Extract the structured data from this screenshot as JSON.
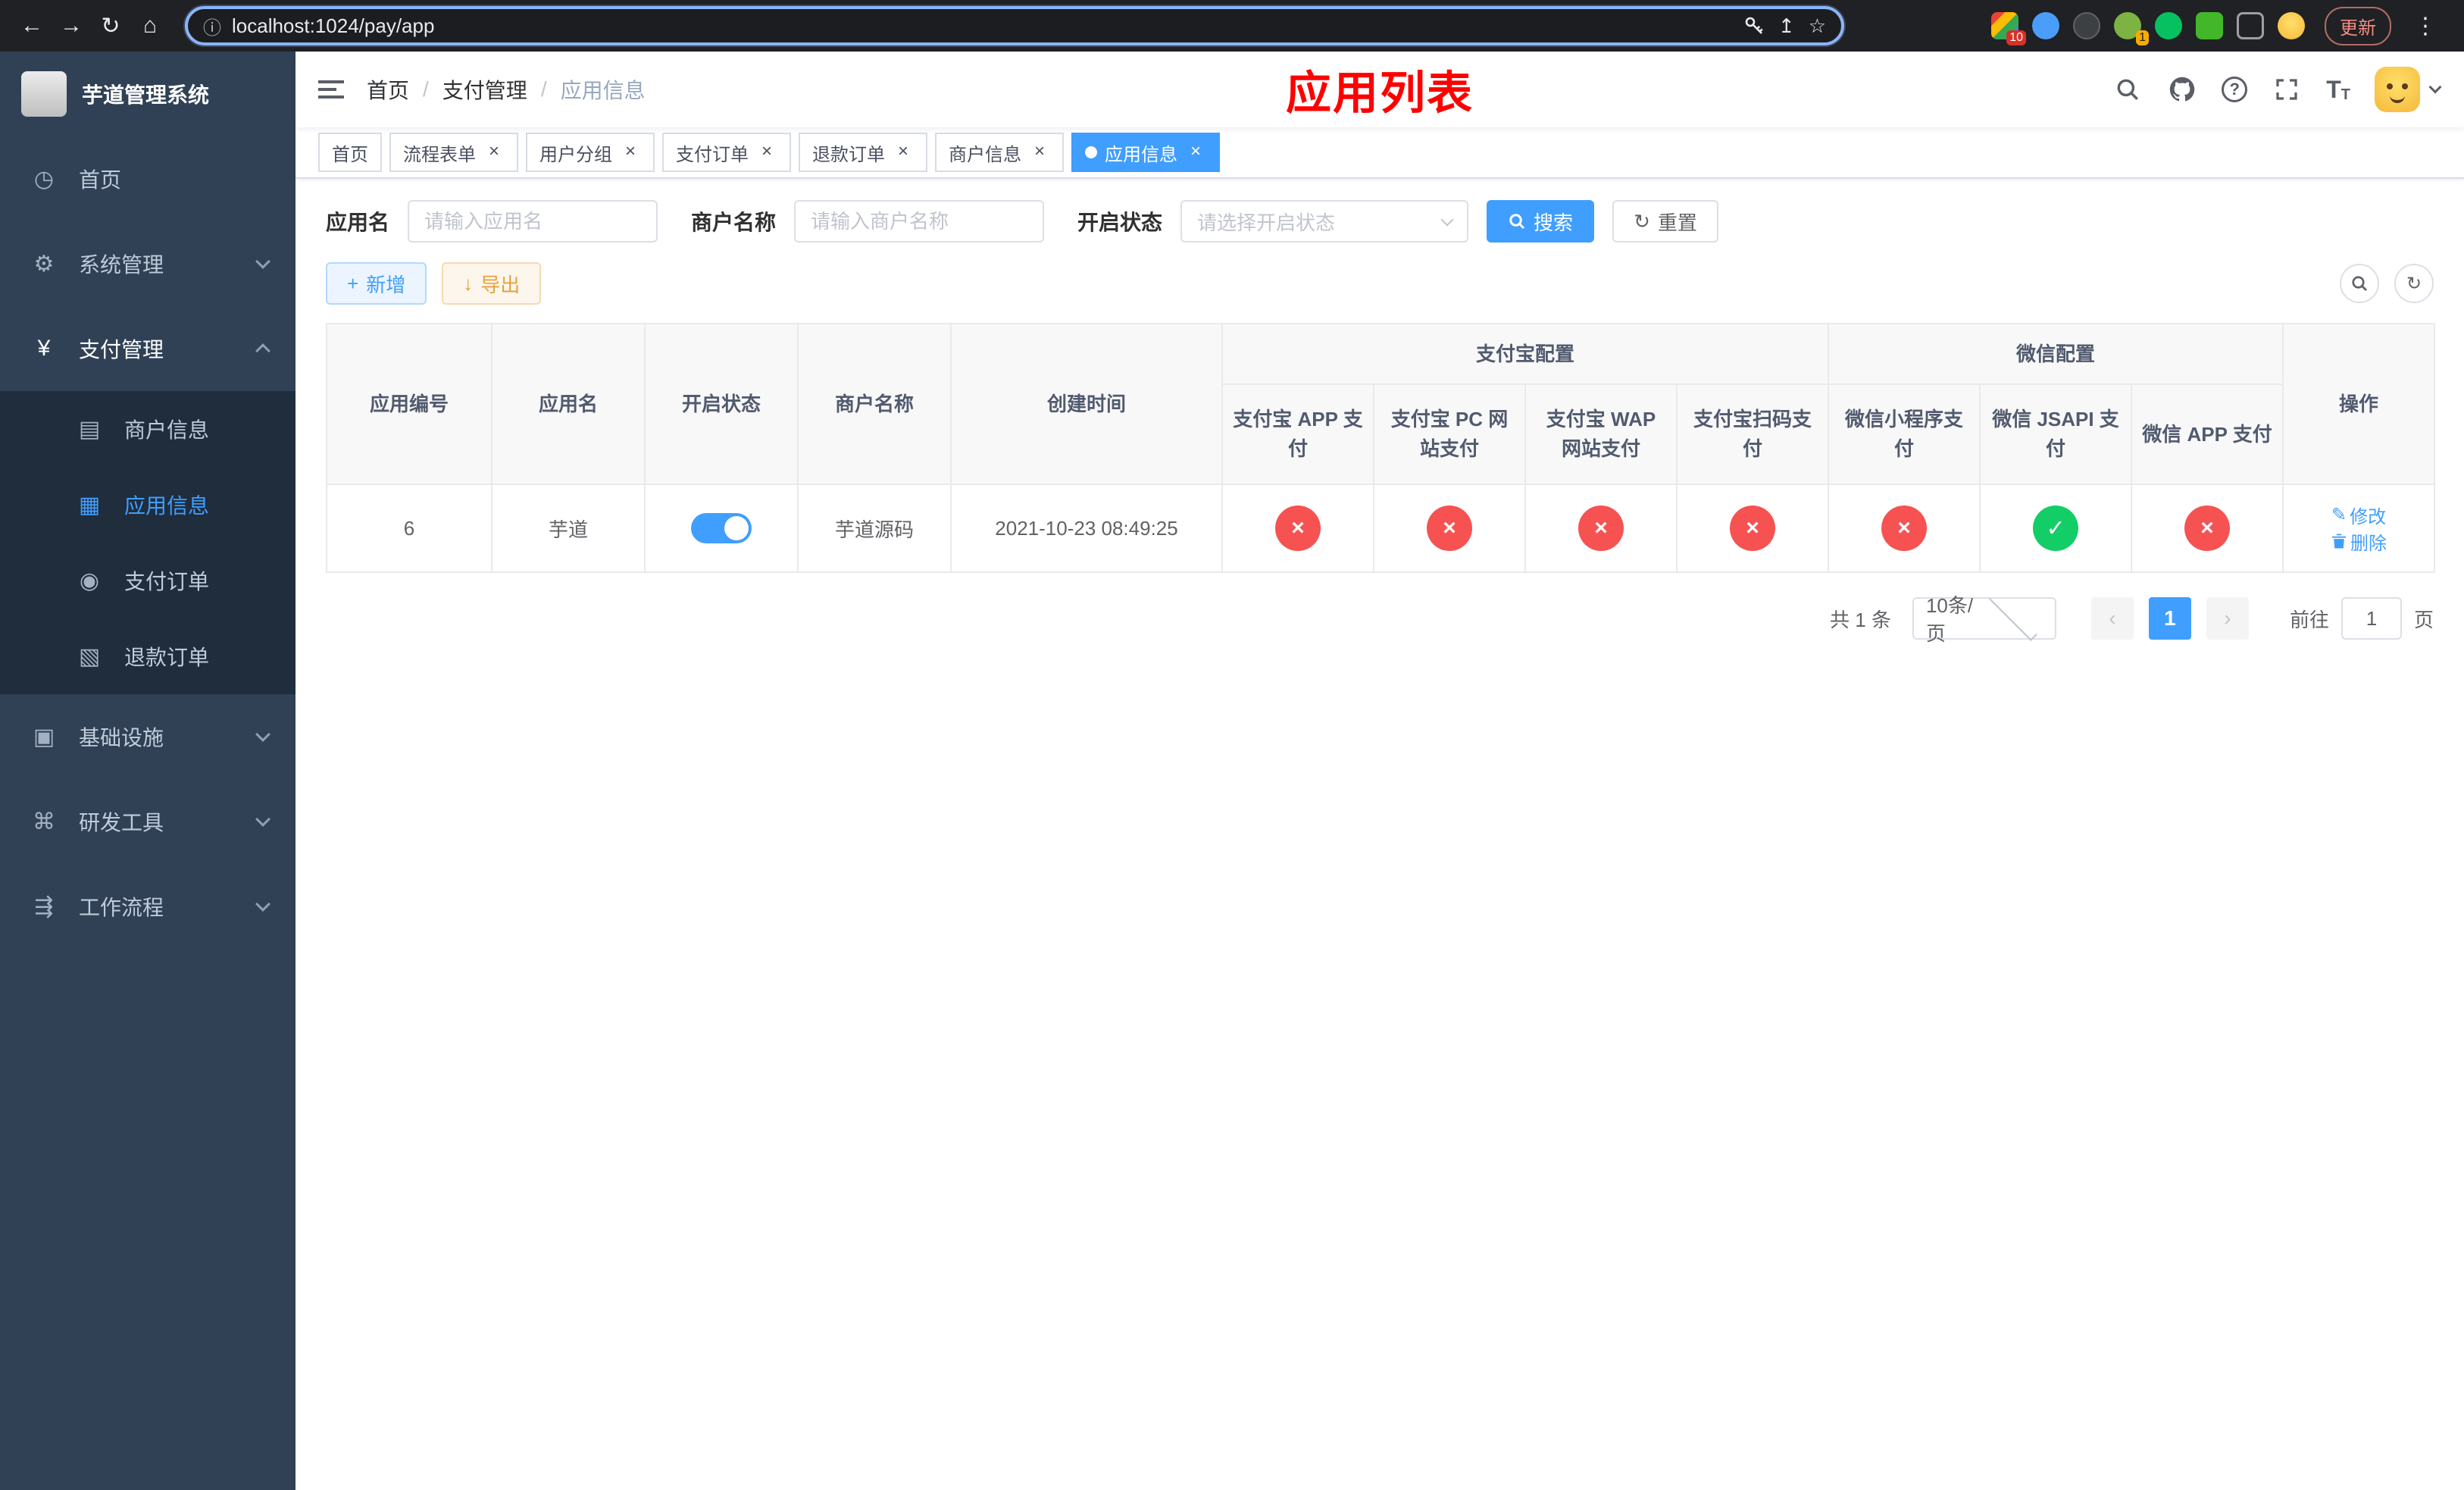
{
  "colors": {
    "accent": "#409eff",
    "title_red": "#ff0000",
    "status_fail": "#f65252",
    "status_ok": "#13ce66",
    "sidebar_bg": "#304156",
    "submenu_bg": "#1f2d3d"
  },
  "browser": {
    "url": "localhost:1024/pay/app",
    "update_label": "更新",
    "ext_badge_red": "10",
    "ext_badge_yellow": "1"
  },
  "icons": {
    "back": "←",
    "forward": "→",
    "reload": "↻",
    "home": "⌂",
    "info": "ⓘ",
    "share": "↥",
    "star": "☆",
    "menu_dots": "⋮",
    "dashboard": "◷",
    "gear": "⚙",
    "yen": "¥",
    "card": "▤",
    "grid": "▦",
    "order": "◉",
    "refund": "▧",
    "infra": "▣",
    "tools": "⌘",
    "flow": "⇶",
    "question": "?",
    "text_size": "T",
    "plus": "+",
    "download": "↓",
    "reset": "↻",
    "edit": "✎",
    "close": "×",
    "prev": "‹",
    "next": "›"
  },
  "sidebar": {
    "title": "芋道管理系统",
    "items": [
      {
        "label": "首页"
      },
      {
        "label": "系统管理"
      },
      {
        "label": "支付管理"
      },
      {
        "label": "商户信息"
      },
      {
        "label": "应用信息"
      },
      {
        "label": "支付订单"
      },
      {
        "label": "退款订单"
      },
      {
        "label": "基础设施"
      },
      {
        "label": "研发工具"
      },
      {
        "label": "工作流程"
      }
    ]
  },
  "navbar": {
    "breadcrumb": {
      "separator": "/",
      "items": [
        {
          "label": "首页"
        },
        {
          "label": "支付管理"
        },
        {
          "label": "应用信息"
        }
      ]
    },
    "page_title": "应用列表"
  },
  "tabs": [
    {
      "label": "首页"
    },
    {
      "label": "流程表单"
    },
    {
      "label": "用户分组"
    },
    {
      "label": "支付订单"
    },
    {
      "label": "退款订单"
    },
    {
      "label": "商户信息"
    },
    {
      "label": "应用信息"
    }
  ],
  "filters": {
    "app_name_label": "应用名",
    "app_name_placeholder": "请输入应用名",
    "merchant_label": "商户名称",
    "merchant_placeholder": "请输入商户名称",
    "status_label": "开启状态",
    "status_placeholder": "请选择开启状态",
    "search_label": "搜索",
    "reset_label": "重置"
  },
  "toolbar": {
    "add_label": "新增",
    "export_label": "导出"
  },
  "table": {
    "headers": {
      "app_id": "应用编号",
      "app_name": "应用名",
      "status": "开启状态",
      "merchant": "商户名称",
      "created": "创建时间",
      "alipay_group": "支付宝配置",
      "wechat_group": "微信配置",
      "alipay_app": "支付宝 APP 支付",
      "alipay_pc": "支付宝 PC 网站支付",
      "alipay_wap": "支付宝 WAP 网站支付",
      "alipay_qr": "支付宝扫码支付",
      "wx_mini": "微信小程序支付",
      "wx_jsapi": "微信 JSAPI 支付",
      "wx_app": "微信 APP 支付",
      "actions": "操作"
    },
    "row": {
      "app_id": "6",
      "app_name": "芋道",
      "status_on": true,
      "merchant": "芋道源码",
      "created": "2021-10-23 08:49:25",
      "statuses": [
        {
          "cls": "chip chip-no",
          "glyph": "×"
        },
        {
          "cls": "chip chip-no",
          "glyph": "×"
        },
        {
          "cls": "chip chip-no",
          "glyph": "×"
        },
        {
          "cls": "chip chip-no",
          "glyph": "×"
        },
        {
          "cls": "chip chip-no",
          "glyph": "×"
        },
        {
          "cls": "chip chip-ok",
          "glyph": "✓"
        },
        {
          "cls": "chip chip-no",
          "glyph": "×"
        }
      ],
      "edit_label": "修改",
      "delete_label": "删除"
    }
  },
  "pagination": {
    "total_text": "共 1 条",
    "page_size": "10条/页",
    "page": "1",
    "goto_label": "前往",
    "goto_value": "1",
    "unit_label": "页"
  }
}
